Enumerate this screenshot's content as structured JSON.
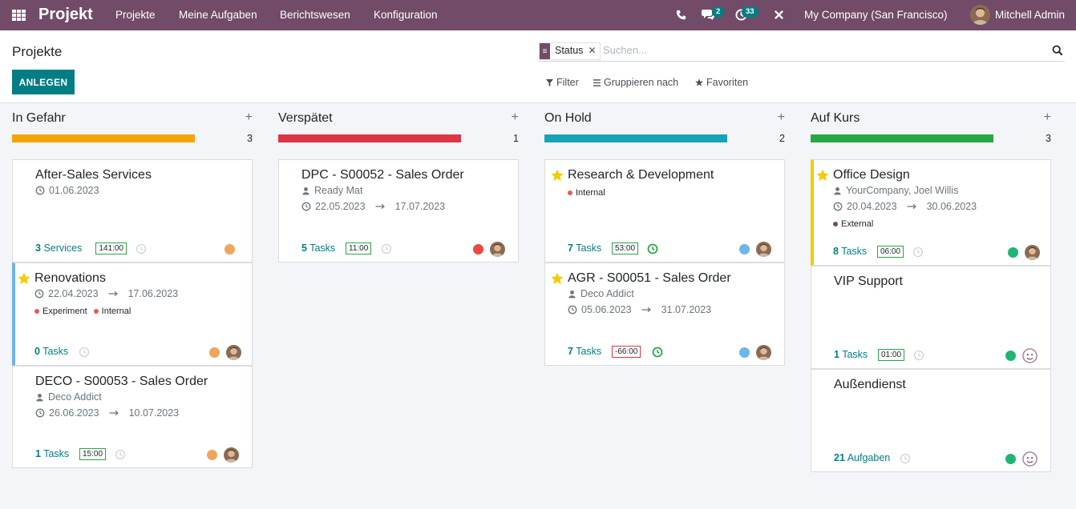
{
  "navbar": {
    "brand": "Projekt",
    "menu": [
      "Projekte",
      "Meine Aufgaben",
      "Berichtswesen",
      "Konfiguration"
    ],
    "messages_count": "2",
    "activities_count": "33",
    "company": "My Company (San Francisco)",
    "user": "Mitchell Admin",
    "icons": {
      "apps": "apps-grid-icon",
      "phone": "phone-icon",
      "messages": "chat-icon",
      "activities": "clock-icon",
      "debug": "tools-icon"
    }
  },
  "control_panel": {
    "breadcrumb": "Projekte",
    "create_label": "ANLEGEN",
    "facet_label": "Status",
    "search_placeholder": "Suchen...",
    "filter_label": "Filter",
    "groupby_label": "Gruppieren nach",
    "favorites_label": "Favoriten"
  },
  "columns": [
    {
      "title": "In Gefahr",
      "count": "3",
      "color": "#f3a506",
      "cards": [
        {
          "title": "After-Sales Services",
          "starred": false,
          "customer": "",
          "date_start": "01.06.2023",
          "date_end": "",
          "tags": [],
          "count_number": "3",
          "count_label": "Services",
          "hours": "141:00",
          "status_color": "#f0a45c",
          "has_avatar": false
        },
        {
          "title": "Renovations",
          "starred": true,
          "customer": "",
          "date_start": "22.04.2023",
          "date_end": "17.06.2023",
          "tags": [
            {
              "label": "Experiment",
              "color": "#e75c4f"
            },
            {
              "label": "Internal",
              "color": "#e75c4f"
            }
          ],
          "count_number": "0",
          "count_label": "Tasks",
          "hours": "",
          "status_color": "#f0a45c",
          "has_avatar": true
        },
        {
          "title": "DECO - S00053 - Sales Order",
          "starred": false,
          "customer": "Deco Addict",
          "date_start": "26.06.2023",
          "date_end": "10.07.2023",
          "tags": [],
          "count_number": "1",
          "count_label": "Tasks",
          "hours": "15:00",
          "status_color": "#f0a45c",
          "has_avatar": true
        }
      ]
    },
    {
      "title": "Verspätet",
      "count": "1",
      "color": "#dc3545",
      "cards": [
        {
          "title": "DPC - S00052 - Sales Order",
          "starred": false,
          "customer": "Ready Mat",
          "date_start": "22.05.2023",
          "date_end": "17.07.2023",
          "tags": [],
          "count_number": "5",
          "count_label": "Tasks",
          "hours": "11:00",
          "status_color": "#e74c3c",
          "has_avatar": true
        }
      ]
    },
    {
      "title": "On Hold",
      "count": "2",
      "color": "#17a2b8",
      "cards": [
        {
          "title": "Research & Development",
          "starred": true,
          "customer": "",
          "date_start": "",
          "date_end": "",
          "tags": [
            {
              "label": "Internal",
              "color": "#e75c4f"
            }
          ],
          "count_number": "7",
          "count_label": "Tasks",
          "hours": "53:00",
          "status_color": "#6cb6e8",
          "has_avatar": true
        },
        {
          "title": "AGR - S00051 - Sales Order",
          "starred": true,
          "customer": "Deco Addict",
          "date_start": "05.06.2023",
          "date_end": "31.07.2023",
          "tags": [],
          "count_number": "7",
          "count_label": "Tasks",
          "hours": "-66:00",
          "status_color": "#6cb6e8",
          "has_avatar": true
        }
      ]
    },
    {
      "title": "Auf Kurs",
      "count": "3",
      "color": "#28a745",
      "cards": [
        {
          "title": "Office Design",
          "starred": true,
          "customer": "YourCompany, Joel Willis",
          "date_start": "20.04.2023",
          "date_end": "30.06.2023",
          "tags": [
            {
              "label": "External",
              "color": "#714b67"
            }
          ],
          "count_number": "8",
          "count_label": "Tasks",
          "hours": "06:00",
          "status_color": "#21b573",
          "has_avatar": true
        },
        {
          "title": "VIP Support",
          "starred": false,
          "customer": "",
          "date_start": "",
          "date_end": "",
          "tags": [],
          "count_number": "1",
          "count_label": "Tasks",
          "hours": "01:00",
          "status_color": "#21b573",
          "has_avatar": false
        },
        {
          "title": "Außendienst",
          "starred": false,
          "customer": "",
          "date_start": "",
          "date_end": "",
          "tags": [],
          "count_number": "21",
          "count_label": "Aufgaben",
          "hours": "",
          "status_color": "#21b573",
          "has_avatar": false
        }
      ]
    }
  ]
}
